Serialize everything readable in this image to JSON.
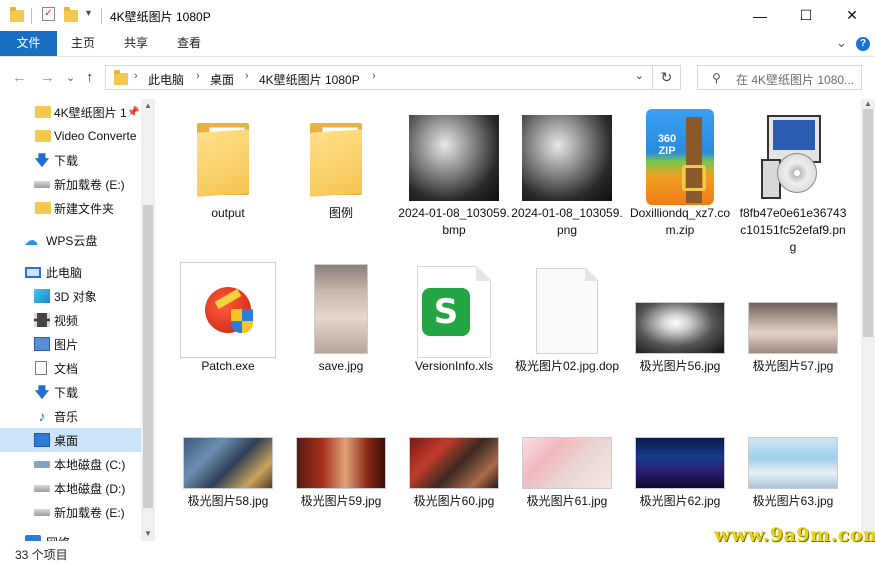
{
  "window": {
    "title": "4K壁纸图片 1080P",
    "minimize": "—",
    "maximize": "☐",
    "close": "✕"
  },
  "ribbon": {
    "tabs": [
      "文件",
      "主页",
      "共享",
      "查看"
    ],
    "expand": "⌄",
    "help": "?"
  },
  "address": {
    "back": "←",
    "forward": "→",
    "recent": "⌄",
    "up": "↑",
    "crumbs": [
      "此电脑",
      "桌面",
      "4K壁纸图片 1080P"
    ],
    "refresh": "↻",
    "search_placeholder": "在 4K壁纸图片 1080..."
  },
  "sidebar": {
    "items": [
      {
        "label": "4K壁纸图片 1",
        "icon": "folder-icon",
        "pinned": true
      },
      {
        "label": "Video Converte",
        "icon": "folder-icon"
      },
      {
        "label": "下载",
        "icon": "download-icon"
      },
      {
        "label": "新加载卷 (E:)",
        "icon": "drive-icon"
      },
      {
        "label": "新建文件夹",
        "icon": "folder-icon"
      },
      {
        "label": "WPS云盘",
        "icon": "cloud-icon"
      },
      {
        "label": "此电脑",
        "icon": "computer-icon"
      },
      {
        "label": "3D 对象",
        "icon": "cube-icon"
      },
      {
        "label": "视频",
        "icon": "video-icon"
      },
      {
        "label": "图片",
        "icon": "pictures-icon"
      },
      {
        "label": "文档",
        "icon": "documents-icon"
      },
      {
        "label": "下载",
        "icon": "download-icon"
      },
      {
        "label": "音乐",
        "icon": "music-icon"
      },
      {
        "label": "桌面",
        "icon": "desktop-icon",
        "selected": true
      },
      {
        "label": "本地磁盘 (C:)",
        "icon": "drive-c-icon"
      },
      {
        "label": "本地磁盘 (D:)",
        "icon": "drive-icon"
      },
      {
        "label": "新加载卷 (E:)",
        "icon": "drive-icon"
      },
      {
        "label": "网络",
        "icon": "network-icon"
      }
    ]
  },
  "files": [
    {
      "name": "output",
      "kind": "folder"
    },
    {
      "name": "图例",
      "kind": "folder"
    },
    {
      "name": "2024-01-08_103059.bmp",
      "kind": "photo-dark"
    },
    {
      "name": "2024-01-08_103059.png",
      "kind": "photo-dark"
    },
    {
      "name": "Doxilliondq_xz7.com.zip",
      "kind": "zip",
      "badge": "360 ZIP"
    },
    {
      "name": "f8fb47e0e61e36743c10151fc52efaf9.png",
      "kind": "installer"
    },
    {
      "name": "Patch.exe",
      "kind": "patch"
    },
    {
      "name": "save.jpg",
      "kind": "portrait-save"
    },
    {
      "name": "VersionInfo.xls",
      "kind": "xls"
    },
    {
      "name": "极光图片02.jpg.dop",
      "kind": "blank"
    },
    {
      "name": "极光图片56.jpg",
      "kind": "p56"
    },
    {
      "name": "极光图片57.jpg",
      "kind": "p57"
    },
    {
      "name": "极光图片58.jpg",
      "kind": "p58"
    },
    {
      "name": "极光图片59.jpg",
      "kind": "p59"
    },
    {
      "name": "极光图片60.jpg",
      "kind": "p60"
    },
    {
      "name": "极光图片61.jpg",
      "kind": "p61"
    },
    {
      "name": "极光图片62.jpg",
      "kind": "p62"
    },
    {
      "name": "极光图片63.jpg",
      "kind": "p63"
    }
  ],
  "status": {
    "count": "33 个项目"
  },
  "watermark": "www.9a9m.com",
  "colors": {
    "accent": "#1a6fc4",
    "selected": "#cce4f7",
    "folder": "#f3c84e"
  }
}
